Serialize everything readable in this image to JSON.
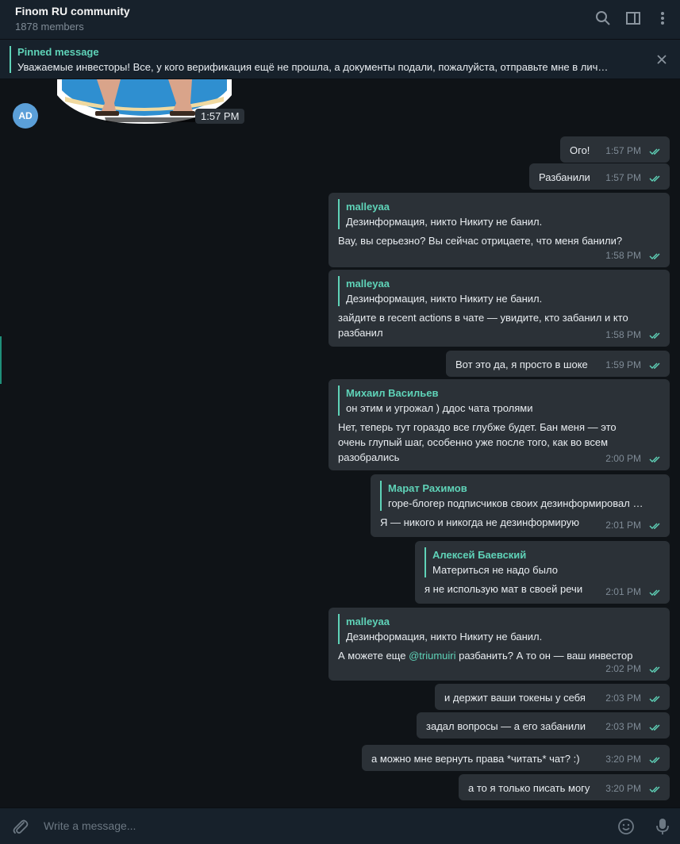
{
  "header": {
    "title": "Finom RU community",
    "members": "1878 members",
    "icons": [
      "search-icon",
      "sidebar-icon",
      "more-icon"
    ]
  },
  "pinned": {
    "title": "Pinned message",
    "text": "Уважаемые инвесторы! Все, у кого верификация ещё не прошла, а документы подали, пожалуйста, отправьте мне в лич…"
  },
  "sticker_message": {
    "avatar_initials": "AD",
    "time": "1:57 PM"
  },
  "messages": [
    {
      "text": "Ого!",
      "time": "1:57 PM"
    },
    {
      "text": "Разбанили",
      "time": "1:57 PM"
    },
    {
      "reply_author": "malleyaa",
      "reply_text": "Дезинформация, никто Никиту не банил.",
      "text": "Вау, вы серьезно? Вы сейчас отрицаете, что меня банили?",
      "time": "1:58 PM"
    },
    {
      "reply_author": "malleyaa",
      "reply_text": "Дезинформация, никто Никиту не банил.",
      "text_line1": "зайдите в recent actions в чате — увидите, кто забанил и кто",
      "text_line2": "разбанил",
      "time": "1:58 PM"
    },
    {
      "text": "Вот это да, я просто в шоке",
      "time": "1:59 PM"
    },
    {
      "reply_author": "Михаил Васильев",
      "reply_text": "он этим и угрожал ) ддос чата тролями",
      "text_line1": "Нет, теперь тут гораздо все глубже будет. Бан меня — это",
      "text_line2": "очень глупый шаг, особенно уже после того, как во всем",
      "text_line3": "разобрались",
      "time": "2:00 PM"
    },
    {
      "reply_author": "Марат Рахимов",
      "reply_text": "горе-блогер подписчиков своих дезинформировал …",
      "text": "Я — никого и никогда не дезинформирую",
      "time": "2:01 PM"
    },
    {
      "reply_author": "Алексей Баевский",
      "reply_text": "Материться не надо было",
      "text": "я не использую мат в своей речи",
      "time": "2:01 PM"
    },
    {
      "reply_author": "malleyaa",
      "reply_text": "Дезинформация, никто Никиту не банил.",
      "text_pre": "А можете еще ",
      "mention": "@triumuiri",
      "text_post": " разбанить? А то он — ваш инвестор",
      "time": "2:02 PM"
    },
    {
      "text": "и держит ваши токены у себя",
      "time": "2:03 PM"
    },
    {
      "text": "задал вопросы — а его забанили",
      "time": "2:03 PM"
    },
    {
      "text": "а можно мне вернуть права *читать* чат? :)",
      "time": "3:20 PM"
    },
    {
      "text": "а то я только писать могу",
      "time": "3:20 PM"
    }
  ],
  "composer": {
    "placeholder": "Write a message...",
    "icons": [
      "attach-icon",
      "emoji-icon",
      "microphone-icon"
    ]
  },
  "colors": {
    "accent": "#5fd3b8",
    "bubble": "#2b3137",
    "header_bg": "#17212b",
    "chat_bg": "#0f1317"
  }
}
